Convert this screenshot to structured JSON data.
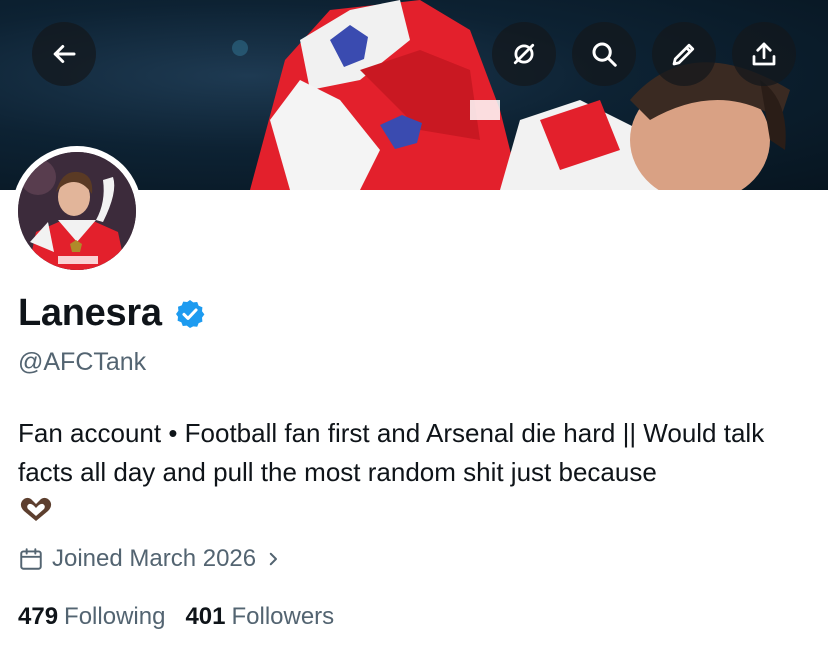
{
  "profile": {
    "display_name": "Lanesra",
    "handle": "@AFCTank",
    "verified": true,
    "bio": "Fan account • Football fan first and Arsenal die hard || Would talk facts all day and pull the most random shit just because",
    "bio_emoji": "heart-hands-emoji",
    "joined": "Joined March 2026",
    "following_count": "479",
    "following_label": "Following",
    "followers_count": "401",
    "followers_label": "Followers"
  },
  "header_buttons": [
    "back-icon",
    "grok-icon",
    "search-icon",
    "edit-icon",
    "share-icon"
  ],
  "colors": {
    "verified_blue": "#1d9bf0",
    "secondary_text": "#536471",
    "primary_text": "#0f1419",
    "arsenal_red": "#e0202c"
  }
}
